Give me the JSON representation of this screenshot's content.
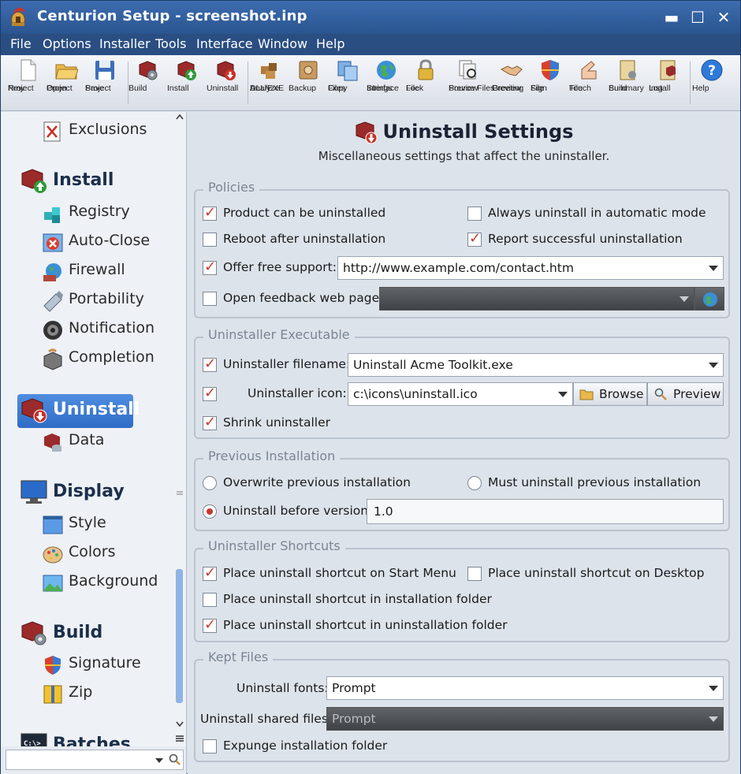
{
  "window": {
    "title": "Centurion Setup - screenshot.inp",
    "minimize": "▬",
    "maximize": "☐",
    "close": "✕"
  },
  "menu": [
    "File",
    "Options",
    "Installer",
    "Tools",
    "Interface",
    "Window",
    "Help"
  ],
  "toolbar": [
    {
      "l1": "New",
      "l2": "Project"
    },
    {
      "l1": "Open",
      "l2": "Project"
    },
    {
      "l1": "Save",
      "l2": "Project"
    },
    {
      "l1": "Build",
      "l2": ""
    },
    {
      "l1": "Install",
      "l2": ""
    },
    {
      "l1": "Uninstall",
      "l2": ""
    },
    {
      "l1": "Analyze",
      "l2": "DLL/EXE"
    },
    {
      "l1": "Backup",
      "l2": ""
    },
    {
      "l1": "Copy",
      "l2": "Files"
    },
    {
      "l1": "Interface",
      "l2": "Strings"
    },
    {
      "l1": "Lock",
      "l2": "File"
    },
    {
      "l1": "Preview",
      "l2": "Source Files"
    },
    {
      "l1": "Preview",
      "l2": "Greeting"
    },
    {
      "l1": "Sign",
      "l2": "File"
    },
    {
      "l1": "Touch",
      "l2": "File"
    },
    {
      "l1": "Build",
      "l2": "Summary"
    },
    {
      "l1": "Install",
      "l2": "Log"
    },
    {
      "l1": "Help",
      "l2": ""
    }
  ],
  "sidebar": {
    "exclusions": "Exclusions",
    "install": "Install",
    "registry": "Registry",
    "auto_close": "Auto-Close",
    "firewall": "Firewall",
    "portability": "Portability",
    "notification": "Notification",
    "completion": "Completion",
    "uninstall": "Uninstall",
    "data": "Data",
    "display": "Display",
    "style": "Style",
    "colors": "Colors",
    "background": "Background",
    "build": "Build",
    "signature": "Signature",
    "zip": "Zip",
    "batches": "Batches"
  },
  "page": {
    "title": "Uninstall Settings",
    "subtitle": "Miscellaneous settings that affect the uninstaller."
  },
  "policies": {
    "legend": "Policies",
    "product_can_be_uninstalled": {
      "label": "Product can be uninstalled",
      "checked": true
    },
    "always_uninstall_automatic": {
      "label": "Always uninstall in automatic mode",
      "checked": false
    },
    "reboot_after": {
      "label": "Reboot after uninstallation",
      "checked": false
    },
    "report_successful": {
      "label": "Report successful uninstallation",
      "checked": true
    },
    "offer_free_support": {
      "label": "Offer free support:",
      "checked": true,
      "value": "http://www.example.com/contact.htm"
    },
    "open_feedback": {
      "label": "Open feedback web page:",
      "checked": false,
      "value": ""
    }
  },
  "executable": {
    "legend": "Uninstaller Executable",
    "filename": {
      "label": "Uninstaller filename:",
      "checked": true,
      "value": "Uninstall Acme Toolkit.exe"
    },
    "icon": {
      "label": "Uninstaller icon:",
      "checked": true,
      "value": "c:\\icons\\uninstall.ico"
    },
    "browse": "Browse",
    "preview": "Preview",
    "shrink": {
      "label": "Shrink uninstaller",
      "checked": true
    }
  },
  "previous": {
    "legend": "Previous Installation",
    "overwrite": {
      "label": "Overwrite previous installation",
      "selected": false
    },
    "must_uninstall": {
      "label": "Must uninstall previous installation",
      "selected": false
    },
    "uninstall_before": {
      "label": "Uninstall before version:",
      "selected": true,
      "value": "1.0"
    }
  },
  "shortcuts": {
    "legend": "Uninstaller Shortcuts",
    "start_menu": {
      "label": "Place uninstall shortcut on Start Menu",
      "checked": true
    },
    "desktop": {
      "label": "Place uninstall shortcut on Desktop",
      "checked": false
    },
    "install_folder": {
      "label": "Place uninstall shortcut in installation folder",
      "checked": false
    },
    "uninstall_folder": {
      "label": "Place uninstall shortcut in uninstallation folder",
      "checked": true
    }
  },
  "kept": {
    "legend": "Kept Files",
    "fonts": {
      "label": "Uninstall fonts:",
      "value": "Prompt"
    },
    "shared": {
      "label": "Uninstall shared files:",
      "value": "Prompt"
    },
    "expunge": {
      "label": "Expunge installation folder",
      "checked": false
    }
  },
  "colors": {
    "titlebar": "#2f5f9f",
    "menubar": "#2a4e82",
    "accent_check": "#c43a2c",
    "selection": "#3a78d2"
  }
}
